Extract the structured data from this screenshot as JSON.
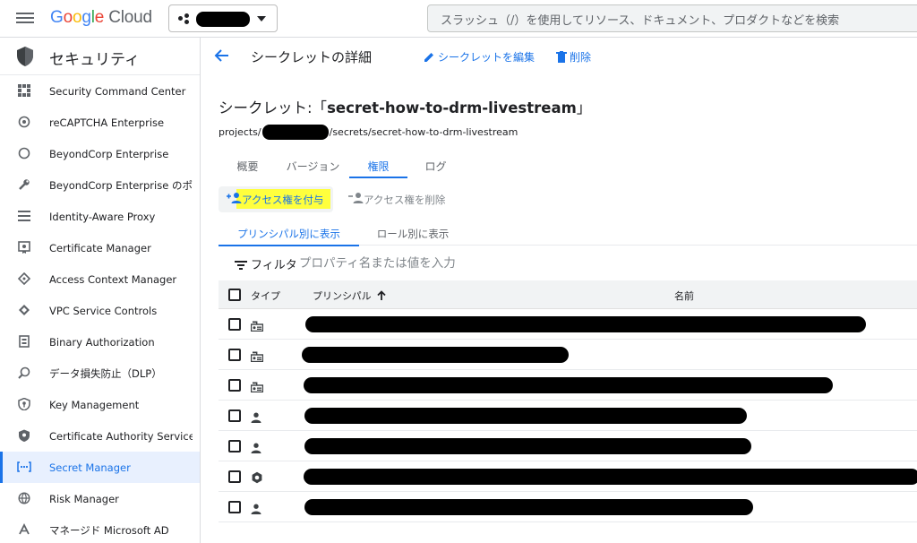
{
  "topbar": {
    "logo_google": "Google",
    "logo_cloud": "Cloud",
    "search_placeholder": "スラッシュ（/）を使用してリソース、ドキュメント、プロダクトなどを検索"
  },
  "sidebar": {
    "title": "セキュリティ",
    "items": [
      {
        "label": "Security Command Center",
        "icon": "grid-icon"
      },
      {
        "label": "reCAPTCHA Enterprise",
        "icon": "recaptcha-icon"
      },
      {
        "label": "BeyondCorp Enterprise",
        "icon": "circle-icon"
      },
      {
        "label": "BeyondCorp Enterprise のポ…",
        "icon": "wrench-icon"
      },
      {
        "label": "Identity-Aware Proxy",
        "icon": "list-icon"
      },
      {
        "label": "Certificate Manager",
        "icon": "certificate-icon"
      },
      {
        "label": "Access Context Manager",
        "icon": "diamond-icon"
      },
      {
        "label": "VPC Service Controls",
        "icon": "vpc-icon"
      },
      {
        "label": "Binary Authorization",
        "icon": "binary-icon"
      },
      {
        "label": "データ損失防止（DLP）",
        "icon": "dlp-icon"
      },
      {
        "label": "Key Management",
        "icon": "key-shield-icon"
      },
      {
        "label": "Certificate Authority Service",
        "icon": "ca-shield-icon"
      },
      {
        "label": "Secret Manager",
        "icon": "secret-icon",
        "active": true
      },
      {
        "label": "Risk Manager",
        "icon": "globe-icon"
      },
      {
        "label": "マネージド Microsoft AD",
        "icon": "ad-icon"
      }
    ]
  },
  "header": {
    "title": "シークレットの詳細",
    "edit_label": "シークレットを編集",
    "delete_label": "削除"
  },
  "secret": {
    "heading_prefix": "シークレット:「",
    "name": "secret-how-to-drm-livestream",
    "heading_suffix": "」",
    "path_prefix": "projects/",
    "path_suffix": "/secrets/secret-how-to-drm-livestream"
  },
  "tabs": [
    {
      "label": "概要"
    },
    {
      "label": "バージョン"
    },
    {
      "label": "権限",
      "active": true
    },
    {
      "label": "ログ"
    }
  ],
  "actions": {
    "grant_label": "アクセス権を付与",
    "remove_label": "アクセス権を削除"
  },
  "subtabs": [
    {
      "label": "プリンシパル別に表示",
      "active": true
    },
    {
      "label": "ロール別に表示"
    }
  ],
  "filter": {
    "label": "フィルタ",
    "placeholder": "プロパティ名または値を入力"
  },
  "table": {
    "col_type": "タイプ",
    "col_principal": "プリンシパル",
    "col_name": "名前",
    "rows": [
      {
        "type": "service-account-icon"
      },
      {
        "type": "service-account-icon"
      },
      {
        "type": "service-account-icon"
      },
      {
        "type": "person-icon"
      },
      {
        "type": "person-icon"
      },
      {
        "type": "google-service-icon"
      },
      {
        "type": "person-icon"
      }
    ]
  },
  "colors": {
    "accent": "#1a73e8",
    "highlight": "#ffff3d",
    "text": "#202124"
  }
}
